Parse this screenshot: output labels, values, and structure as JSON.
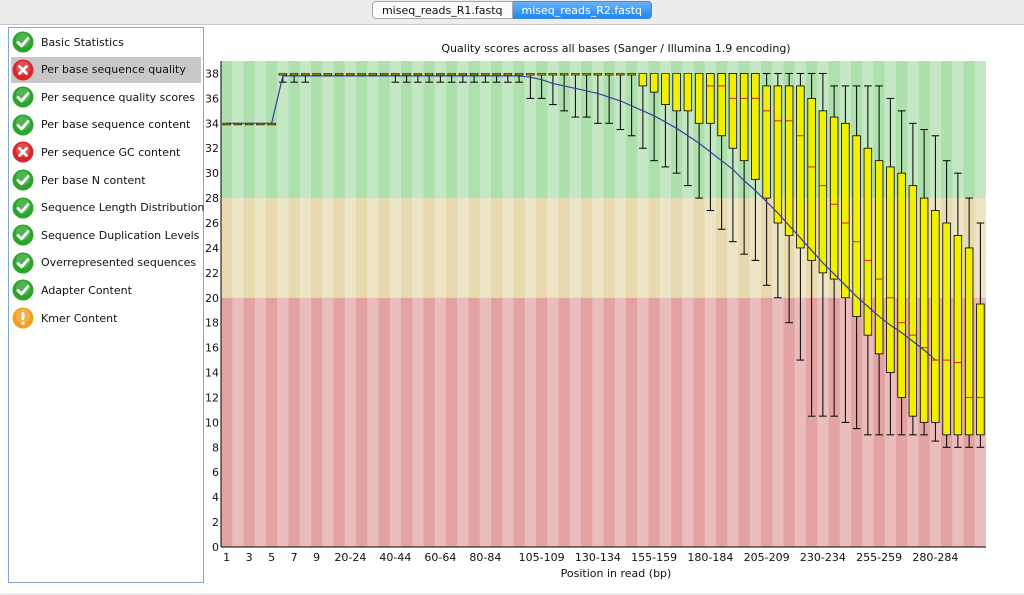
{
  "tabs": [
    {
      "label": "miseq_reads_R1.fastq",
      "active": false
    },
    {
      "label": "miseq_reads_R2.fastq",
      "active": true
    }
  ],
  "modules": [
    {
      "label": "Basic Statistics",
      "status": "pass",
      "icon": "check-icon"
    },
    {
      "label": "Per base sequence quality",
      "status": "fail",
      "icon": "cross-icon",
      "selected": true
    },
    {
      "label": "Per sequence quality scores",
      "status": "pass",
      "icon": "check-icon"
    },
    {
      "label": "Per base sequence content",
      "status": "pass",
      "icon": "check-icon"
    },
    {
      "label": "Per sequence GC content",
      "status": "fail",
      "icon": "cross-icon"
    },
    {
      "label": "Per base N content",
      "status": "pass",
      "icon": "check-icon"
    },
    {
      "label": "Sequence Length Distribution",
      "status": "pass",
      "icon": "check-icon"
    },
    {
      "label": "Sequence Duplication Levels",
      "status": "pass",
      "icon": "check-icon"
    },
    {
      "label": "Overrepresented sequences",
      "status": "pass",
      "icon": "check-icon"
    },
    {
      "label": "Adapter Content",
      "status": "pass",
      "icon": "check-icon"
    },
    {
      "label": "Kmer Content",
      "status": "warn",
      "icon": "warning-icon"
    }
  ],
  "colors": {
    "pass": "#2aa52a",
    "fail": "#d9262b",
    "warn": "#f0a020",
    "box": "#f0f000",
    "mean_line": "#3c3ca0",
    "median": "#d22020",
    "zone_good": "#aee0ae",
    "zone_ok": "#e8dab0",
    "zone_bad": "#e3a3a3"
  },
  "chart_data": {
    "type": "boxplot",
    "title": "Quality scores across all bases (Sanger / Illumina 1.9 encoding)",
    "xlabel": "Position in read (bp)",
    "ylabel": "",
    "ylim": [
      0,
      39
    ],
    "yticks": [
      0,
      2,
      4,
      6,
      8,
      10,
      12,
      14,
      16,
      18,
      20,
      22,
      24,
      26,
      28,
      30,
      32,
      34,
      36,
      38
    ],
    "zones": [
      {
        "name": "good",
        "from": 28,
        "to": 39
      },
      {
        "name": "ok",
        "from": 20,
        "to": 28
      },
      {
        "name": "poor",
        "from": 0,
        "to": 20
      }
    ],
    "categories": [
      "1",
      "2",
      "3",
      "4",
      "5",
      "6",
      "7",
      "8",
      "9",
      "10-14",
      "15-19",
      "20-24",
      "25-29",
      "30-34",
      "35-39",
      "40-44",
      "45-49",
      "50-54",
      "55-59",
      "60-64",
      "65-69",
      "70-74",
      "75-79",
      "80-84",
      "85-89",
      "90-94",
      "95-99",
      "100-104",
      "105-109",
      "110-114",
      "115-119",
      "120-124",
      "125-129",
      "130-134",
      "135-139",
      "140-144",
      "145-149",
      "150-154",
      "155-159",
      "160-164",
      "165-169",
      "170-174",
      "175-179",
      "180-184",
      "185-189",
      "190-194",
      "195-199",
      "200-204",
      "205-209",
      "210-214",
      "215-219",
      "220-224",
      "225-229",
      "230-234",
      "235-239",
      "240-244",
      "245-249",
      "250-254",
      "255-259",
      "260-264",
      "265-269",
      "270-274",
      "275-279",
      "280-284",
      "285-289",
      "290-294",
      "295-299",
      "300-301"
    ],
    "tick_labels": [
      "1",
      "3",
      "5",
      "7",
      "9",
      "20-24",
      "40-44",
      "60-64",
      "80-84",
      "105-109",
      "130-134",
      "155-159",
      "180-184",
      "205-209",
      "230-234",
      "255-259",
      "280-284"
    ],
    "series": [
      {
        "name": "q10",
        "values": [
          34,
          34,
          34,
          34,
          34,
          37.3,
          37.3,
          37.3,
          38,
          38,
          38,
          38,
          38,
          38,
          38,
          37.3,
          37.3,
          37.3,
          37.3,
          37.3,
          37.3,
          37.3,
          37.3,
          37.3,
          37.3,
          37.3,
          37.3,
          36,
          36,
          35.5,
          35,
          34.5,
          34.5,
          34,
          34,
          33.5,
          33,
          32,
          31,
          30.5,
          30,
          29,
          28,
          27,
          25.5,
          24.5,
          23.5,
          23,
          21,
          20,
          18,
          15,
          10.5,
          10.5,
          10.5,
          10,
          9.5,
          9,
          9,
          9,
          9,
          9,
          9,
          8.5,
          8,
          8,
          8,
          8
        ]
      },
      {
        "name": "q25",
        "values": [
          34,
          34,
          34,
          34,
          34,
          38,
          38,
          38,
          38,
          38,
          38,
          38,
          38,
          38,
          38,
          38,
          38,
          38,
          38,
          38,
          38,
          38,
          38,
          38,
          38,
          38,
          38,
          38,
          38,
          38,
          38,
          38,
          38,
          38,
          38,
          38,
          38,
          37,
          36.5,
          35.5,
          35,
          35,
          34,
          34,
          33,
          32,
          31,
          29.5,
          28,
          26,
          25,
          24,
          23,
          22,
          21.5,
          20,
          18.5,
          17,
          15.5,
          14,
          12,
          10.5,
          10,
          10,
          9,
          9,
          9,
          9
        ]
      },
      {
        "name": "median",
        "values": [
          34,
          34,
          34,
          34,
          34,
          38,
          38,
          38,
          38,
          38,
          38,
          38,
          38,
          38,
          38,
          38,
          38,
          38,
          38,
          38,
          38,
          38,
          38,
          38,
          38,
          38,
          38,
          38,
          38,
          38,
          38,
          38,
          38,
          38,
          38,
          38,
          38,
          38,
          38,
          38,
          38,
          38,
          38,
          37,
          37,
          36,
          36,
          36,
          35,
          34.2,
          34.2,
          33,
          30.5,
          29,
          27.5,
          26,
          24.5,
          23,
          21.5,
          20,
          18,
          17,
          16,
          15,
          15,
          14.8,
          12,
          12
        ]
      },
      {
        "name": "q75",
        "values": [
          34,
          34,
          34,
          34,
          34,
          38,
          38,
          38,
          38,
          38,
          38,
          38,
          38,
          38,
          38,
          38,
          38,
          38,
          38,
          38,
          38,
          38,
          38,
          38,
          38,
          38,
          38,
          38,
          38,
          38,
          38,
          38,
          38,
          38,
          38,
          38,
          38,
          38,
          38,
          38,
          38,
          38,
          38,
          38,
          38,
          38,
          38,
          38,
          37,
          37,
          37,
          37,
          36,
          35,
          34.5,
          34,
          33,
          32,
          31,
          30.5,
          30,
          29,
          28,
          27,
          26,
          25,
          24,
          19.5
        ]
      },
      {
        "name": "q90",
        "values": [
          34,
          34,
          34,
          34,
          34,
          38,
          38,
          38,
          38,
          38,
          38,
          38,
          38,
          38,
          38,
          38,
          38,
          38,
          38,
          38,
          38,
          38,
          38,
          38,
          38,
          38,
          38,
          38,
          38,
          38,
          38,
          38,
          38,
          38,
          38,
          38,
          38,
          38,
          38,
          38,
          38,
          38,
          38,
          38,
          38,
          38,
          38,
          38,
          38,
          38,
          38,
          38,
          38,
          38,
          37,
          37,
          37,
          37,
          37,
          36,
          35,
          34,
          33.5,
          33,
          31,
          30,
          28,
          26
        ]
      },
      {
        "name": "mean",
        "values": [
          34,
          34,
          34,
          34,
          34,
          37.8,
          37.8,
          37.8,
          37.8,
          37.8,
          37.8,
          37.8,
          37.8,
          37.8,
          37.8,
          37.8,
          37.8,
          37.8,
          37.8,
          37.8,
          37.8,
          37.8,
          37.8,
          37.8,
          37.8,
          37.8,
          37.8,
          37.7,
          37.5,
          37.2,
          37.0,
          36.8,
          36.6,
          36.4,
          36.1,
          35.8,
          35.4,
          35.0,
          34.6,
          34.1,
          33.6,
          33.0,
          32.4,
          31.7,
          31.0,
          30.3,
          29.4,
          28.6,
          27.7,
          26.8,
          25.8,
          24.8,
          23.8,
          22.8,
          21.9,
          21.0,
          20.1,
          19.3,
          18.5,
          17.8,
          17.2,
          16.5,
          15.8,
          15.0
        ]
      }
    ]
  }
}
